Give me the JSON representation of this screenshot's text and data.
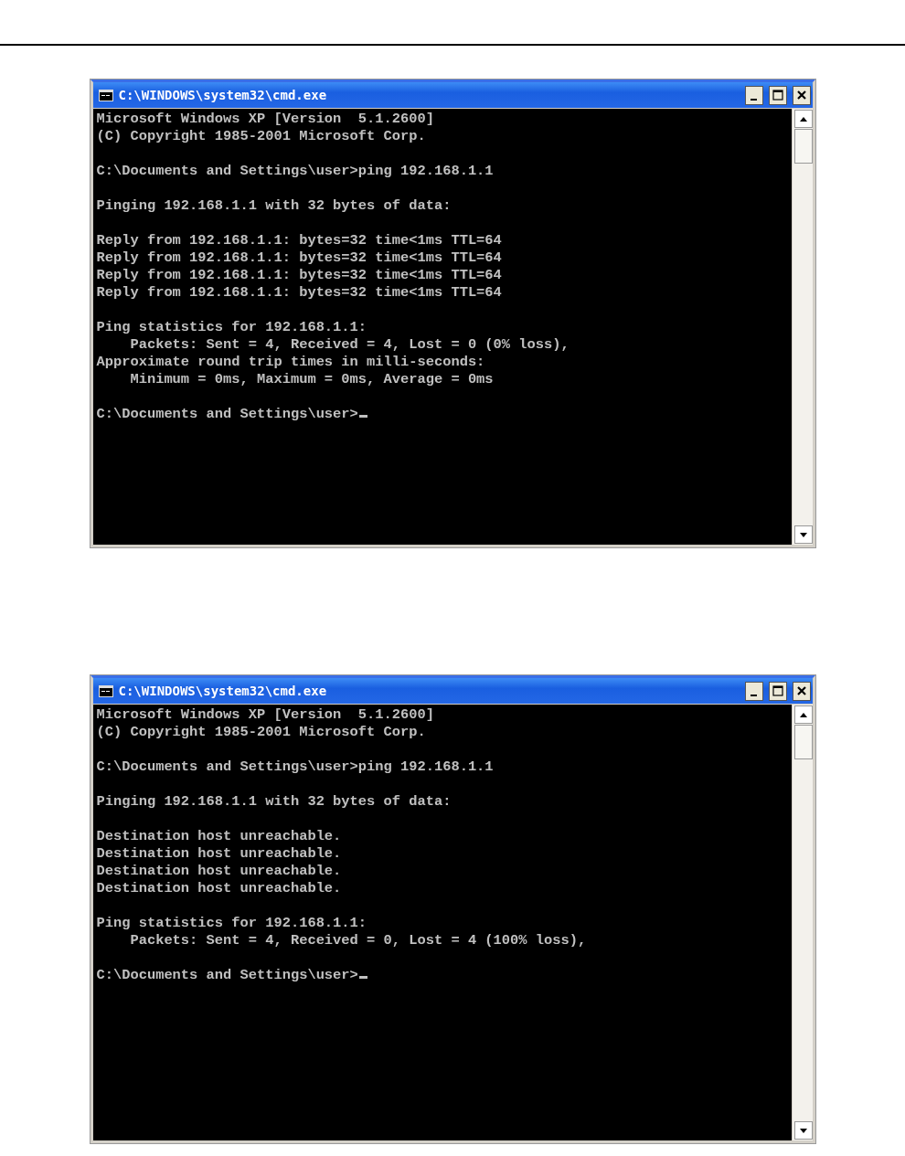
{
  "windows": [
    {
      "title": "C:\\WINDOWS\\system32\\cmd.exe",
      "blocks": [
        [
          "Microsoft Windows XP [Version  5.1.2600]",
          "(C) Copyright 1985-2001 Microsoft Corp."
        ],
        [
          "C:\\Documents and Settings\\user>ping 192.168.1.1"
        ],
        [
          "Pinging 192.168.1.1 with 32 bytes of data:"
        ],
        [
          "Reply from 192.168.1.1: bytes=32 time<1ms TTL=64",
          "Reply from 192.168.1.1: bytes=32 time<1ms TTL=64",
          "Reply from 192.168.1.1: bytes=32 time<1ms TTL=64",
          "Reply from 192.168.1.1: bytes=32 time<1ms TTL=64"
        ],
        [
          "Ping statistics for 192.168.1.1:",
          "    Packets: Sent = 4, Received = 4, Lost = 0 (0% loss),",
          "Approximate round trip times in milli-seconds:",
          "    Minimum = 0ms, Maximum = 0ms, Average = 0ms"
        ],
        [
          "C:\\Documents and Settings\\user>"
        ]
      ]
    },
    {
      "title": "C:\\WINDOWS\\system32\\cmd.exe",
      "blocks": [
        [
          "Microsoft Windows XP [Version  5.1.2600]",
          "(C) Copyright 1985-2001 Microsoft Corp."
        ],
        [
          "C:\\Documents and Settings\\user>ping 192.168.1.1"
        ],
        [
          "Pinging 192.168.1.1 with 32 bytes of data:"
        ],
        [
          "Destination host unreachable.",
          "Destination host unreachable.",
          "Destination host unreachable.",
          "Destination host unreachable."
        ],
        [
          "Ping statistics for 192.168.1.1:",
          "    Packets: Sent = 4, Received = 0, Lost = 4 (100% loss),"
        ],
        [
          "C:\\Documents and Settings\\user>"
        ]
      ]
    }
  ]
}
